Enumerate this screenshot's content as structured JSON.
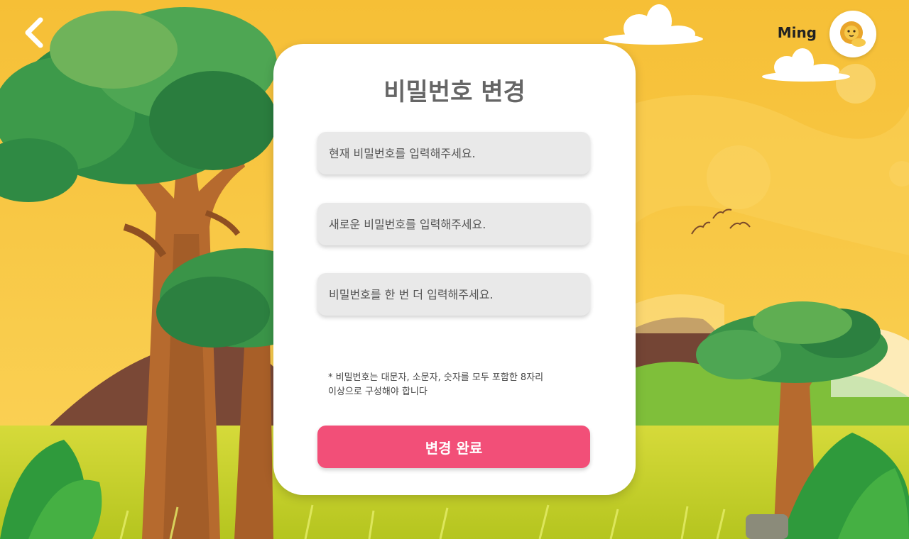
{
  "header": {
    "back_icon": "chevron-left-icon",
    "user_name": "Ming",
    "avatar_icon": "lion-avatar-icon"
  },
  "form": {
    "title": "비밀번호 변경",
    "current_password": {
      "value": "",
      "placeholder": "현재 비밀번호를 입력해주세요."
    },
    "new_password": {
      "value": "",
      "placeholder": "새로운 비밀번호를 입력해주세요."
    },
    "confirm_password": {
      "value": "",
      "placeholder": "비밀번호를 한 번 더 입력해주세요."
    },
    "hint_line1": "* 비밀번호는 대문자, 소문자, 숫자를 모두 포함한 8자리",
    "hint_line2": "이상으로 구성해야 합니다",
    "submit_label": "변경 완료"
  },
  "colors": {
    "sky": "#f7c43d",
    "grass": "#c8d42a",
    "submit_button": "#f24f78",
    "field_background": "#e9e9e9"
  }
}
